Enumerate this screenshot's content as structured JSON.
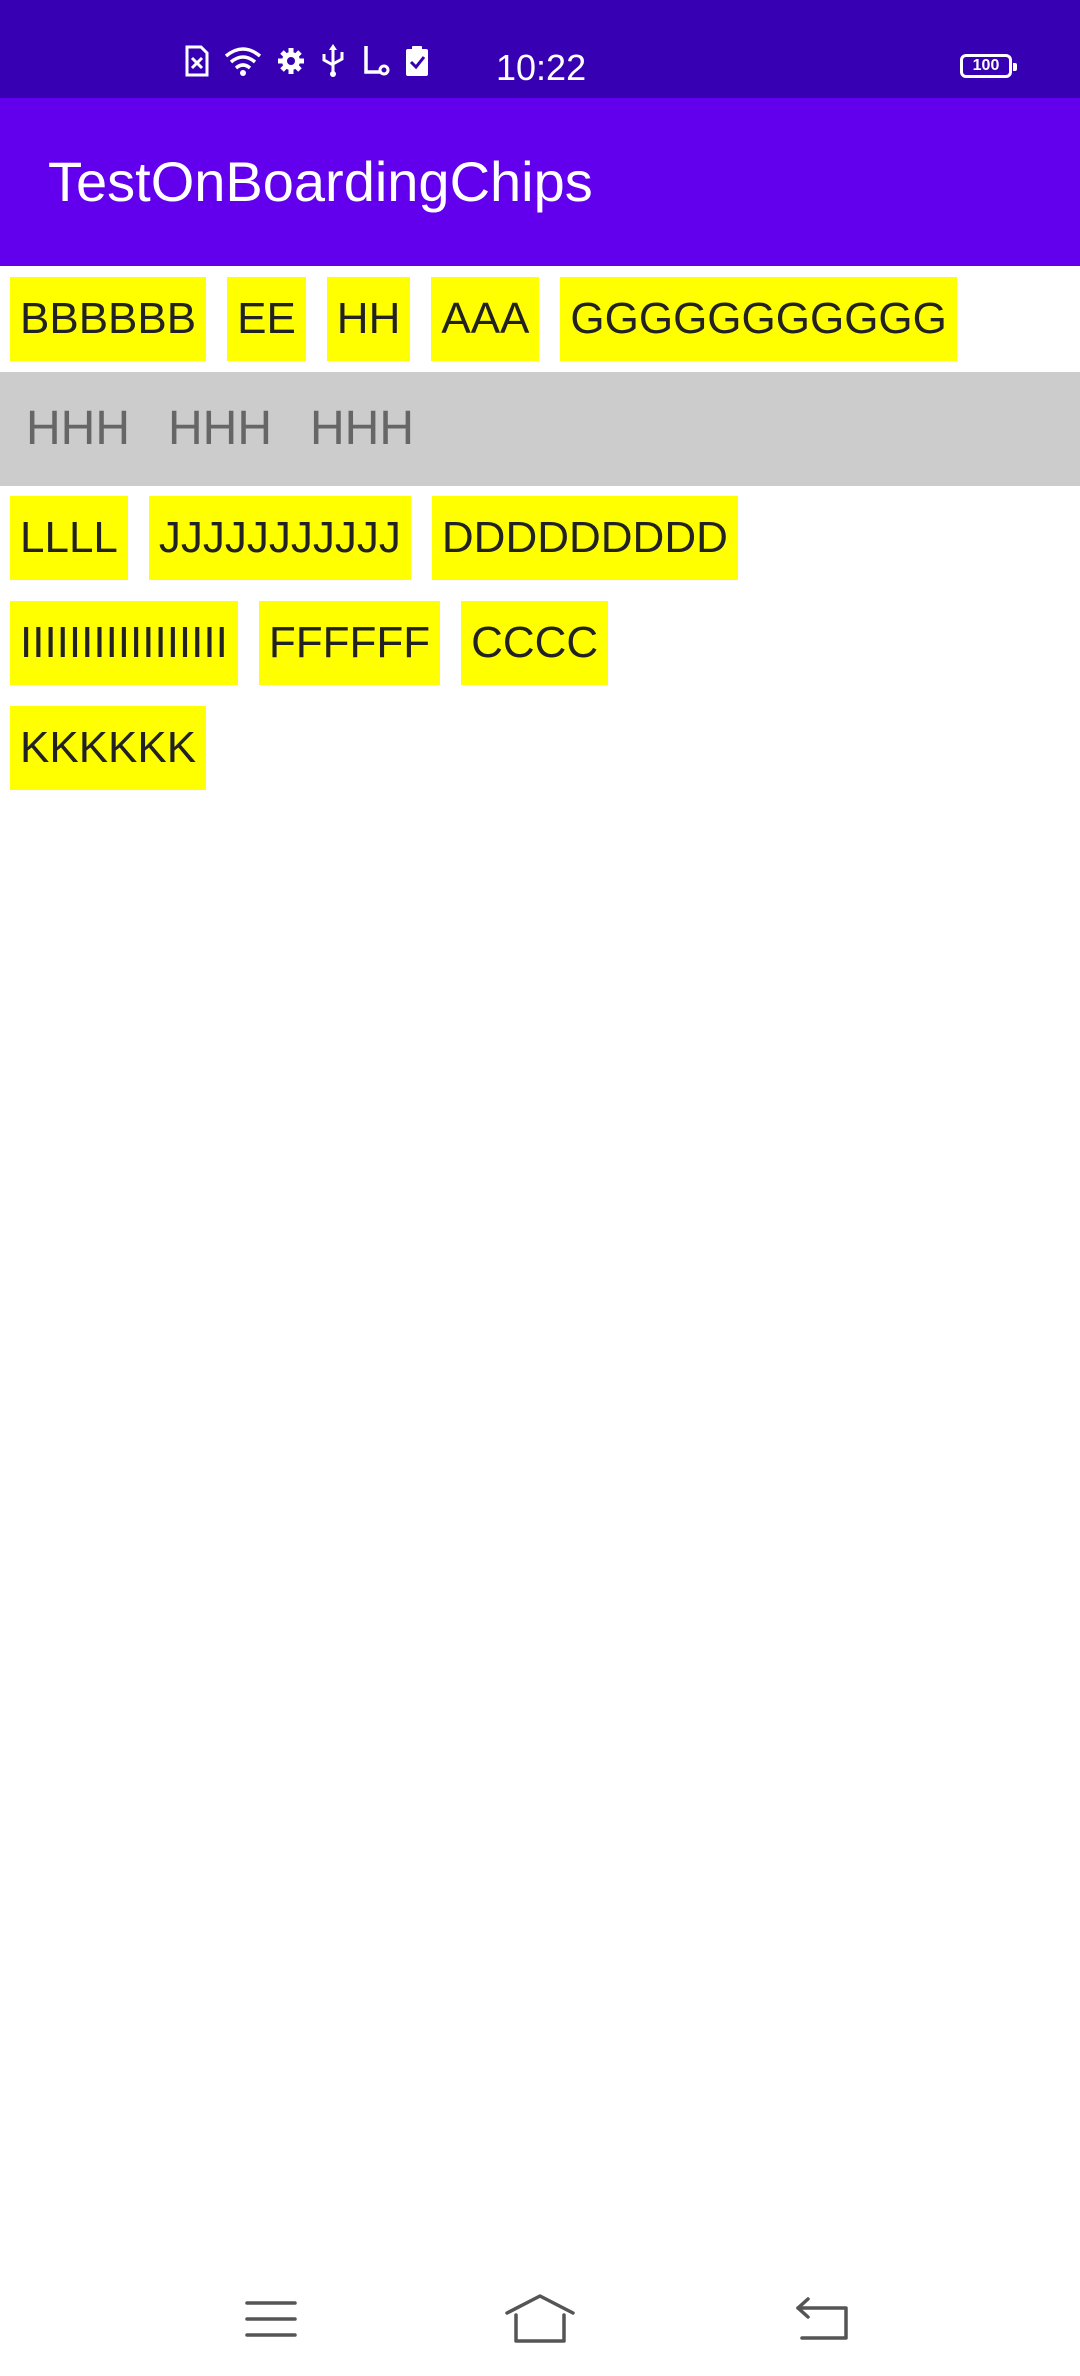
{
  "status_bar": {
    "time": "10:22",
    "battery_level": "100",
    "icons": [
      "sim-error-icon",
      "wifi-icon",
      "settings-gear-icon",
      "usb-icon",
      "notification-icon",
      "clipboard-check-icon"
    ],
    "background_color": "#3700b3"
  },
  "app_bar": {
    "title": "TestOnBoardingChips",
    "background_color": "#6200ee"
  },
  "chips_row_1": [
    {
      "label": "BBBBBB"
    },
    {
      "label": "EE"
    },
    {
      "label": "HH"
    },
    {
      "label": "AAA"
    },
    {
      "label": "GGGGGGGGGGG"
    }
  ],
  "gray_strip": [
    {
      "label": "HHH"
    },
    {
      "label": "HHH"
    },
    {
      "label": "HHH"
    }
  ],
  "chips_row_2": [
    {
      "label": "LLLL"
    },
    {
      "label": "JJJJJJJJJJJ"
    },
    {
      "label": "DDDDDDDDD"
    }
  ],
  "chips_row_3": [
    {
      "label": "IIIIIIIIIIIIIIIII"
    },
    {
      "label": "FFFFFF"
    },
    {
      "label": "CCCC"
    }
  ],
  "chips_row_4": [
    {
      "label": "KKKKKK"
    }
  ],
  "chip_color": "#ffff00",
  "nav_bar": {
    "icons": [
      "menu-icon",
      "home-icon",
      "back-icon"
    ]
  }
}
